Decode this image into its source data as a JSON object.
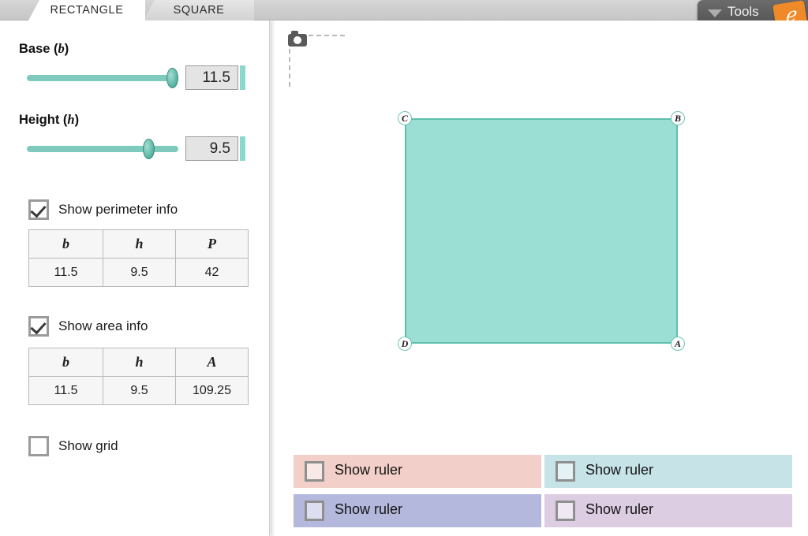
{
  "tabs": [
    {
      "label": "RECTANGLE",
      "active": true
    },
    {
      "label": "SQUARE",
      "active": false
    }
  ],
  "tools": {
    "label": "Tools",
    "caret_icon": "chevron-down-icon",
    "logo_glyph": "ℯ",
    "bg_color": "#545454",
    "logo_color": "#f08a28"
  },
  "sidebar": {
    "base": {
      "label_text": "Base (",
      "label_var": "b",
      "label_close": ")",
      "value": "11.5",
      "slider_fill_percent": 96,
      "accent_color": "#8bd9cc"
    },
    "height": {
      "label_text": "Height (",
      "label_var": "h",
      "label_close": ")",
      "value": "9.5",
      "slider_fill_percent": 80,
      "accent_color": "#8bd9cc"
    },
    "perimeter": {
      "checkbox_label": "Show perimeter info",
      "checked": true,
      "headers": [
        "b",
        "h",
        "P"
      ],
      "values": [
        "11.5",
        "9.5",
        "42"
      ]
    },
    "area": {
      "checkbox_label": "Show area info",
      "checked": true,
      "headers": [
        "b",
        "h",
        "A"
      ],
      "values": [
        "11.5",
        "9.5",
        "109.25"
      ]
    },
    "grid": {
      "checkbox_label": "Show grid",
      "checked": false
    }
  },
  "canvas": {
    "camera_icon": "camera-icon",
    "shape": {
      "fill_color": "#9bdfd4",
      "stroke_color": "#5fbfae",
      "vertices": [
        {
          "name": "C",
          "position": "top-left"
        },
        {
          "name": "B",
          "position": "top-right"
        },
        {
          "name": "D",
          "position": "bottom-left"
        },
        {
          "name": "A",
          "position": "bottom-right"
        }
      ]
    },
    "rulers": [
      {
        "label": "Show ruler",
        "checked": false,
        "color": "#f2cfc8"
      },
      {
        "label": "Show ruler",
        "checked": false,
        "color": "#c6e3e8"
      },
      {
        "label": "Show ruler",
        "checked": false,
        "color": "#b4b8dd"
      },
      {
        "label": "Show ruler",
        "checked": false,
        "color": "#ddcde2"
      }
    ]
  }
}
